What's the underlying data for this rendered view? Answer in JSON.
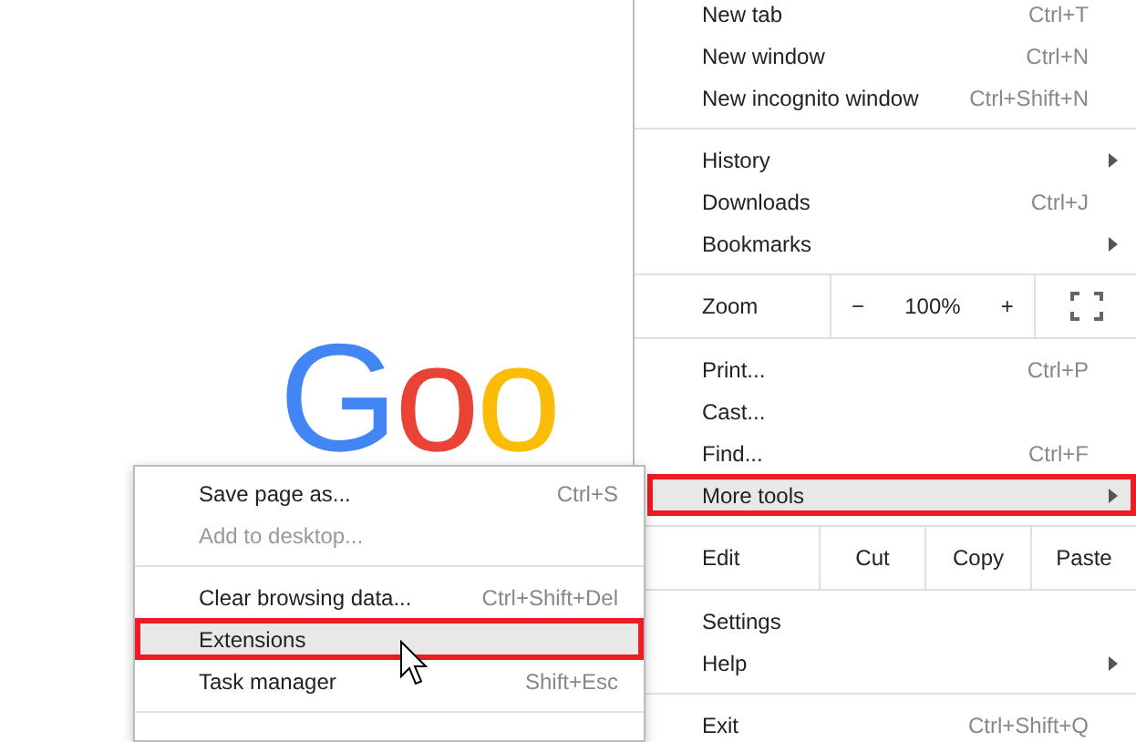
{
  "page": {
    "logo": "Goo"
  },
  "menu": {
    "items": [
      {
        "kind": "item",
        "label": "New tab",
        "shortcut": "Ctrl+T",
        "submenu": false,
        "selected": false,
        "highlighted": false
      },
      {
        "kind": "item",
        "label": "New window",
        "shortcut": "Ctrl+N",
        "submenu": false,
        "selected": false,
        "highlighted": false
      },
      {
        "kind": "item",
        "label": "New incognito window",
        "shortcut": "Ctrl+Shift+N",
        "submenu": false,
        "selected": false,
        "highlighted": false
      },
      {
        "kind": "separator"
      },
      {
        "kind": "item",
        "label": "History",
        "submenu": true,
        "selected": false,
        "highlighted": false
      },
      {
        "kind": "item",
        "label": "Downloads",
        "shortcut": "Ctrl+J",
        "submenu": false,
        "selected": false,
        "highlighted": false
      },
      {
        "kind": "item",
        "label": "Bookmarks",
        "submenu": true,
        "selected": false,
        "highlighted": false
      },
      {
        "kind": "zoom",
        "label": "Zoom",
        "minus": "−",
        "value": "100%",
        "plus": "+"
      },
      {
        "kind": "item",
        "label": "Print...",
        "shortcut": "Ctrl+P",
        "submenu": false,
        "selected": false,
        "highlighted": false
      },
      {
        "kind": "item",
        "label": "Cast...",
        "submenu": false,
        "selected": false,
        "highlighted": false
      },
      {
        "kind": "item",
        "label": "Find...",
        "shortcut": "Ctrl+F",
        "submenu": false,
        "selected": false,
        "highlighted": false
      },
      {
        "kind": "item",
        "label": "More tools",
        "submenu": true,
        "selected": true,
        "highlighted": true
      },
      {
        "kind": "edit",
        "label": "Edit",
        "buttons": [
          "Cut",
          "Copy",
          "Paste"
        ]
      },
      {
        "kind": "item",
        "label": "Settings",
        "submenu": false,
        "selected": false,
        "highlighted": false
      },
      {
        "kind": "item",
        "label": "Help",
        "submenu": true,
        "selected": false,
        "highlighted": false
      },
      {
        "kind": "separator"
      },
      {
        "kind": "item",
        "label": "Exit",
        "shortcut": "Ctrl+Shift+Q",
        "submenu": false,
        "selected": false,
        "highlighted": false
      }
    ]
  },
  "submenu": {
    "items": [
      {
        "kind": "item",
        "label": "Save page as...",
        "shortcut": "Ctrl+S",
        "disabled": false,
        "selected": false,
        "highlighted": false
      },
      {
        "kind": "item",
        "label": "Add to desktop...",
        "disabled": true,
        "selected": false,
        "highlighted": false
      },
      {
        "kind": "separator"
      },
      {
        "kind": "item",
        "label": "Clear browsing data...",
        "shortcut": "Ctrl+Shift+Del",
        "disabled": false,
        "selected": false,
        "highlighted": false
      },
      {
        "kind": "item",
        "label": "Extensions",
        "disabled": false,
        "selected": true,
        "highlighted": true
      },
      {
        "kind": "item",
        "label": "Task manager",
        "shortcut": "Shift+Esc",
        "disabled": false,
        "selected": false,
        "highlighted": false
      },
      {
        "kind": "separator"
      }
    ]
  }
}
